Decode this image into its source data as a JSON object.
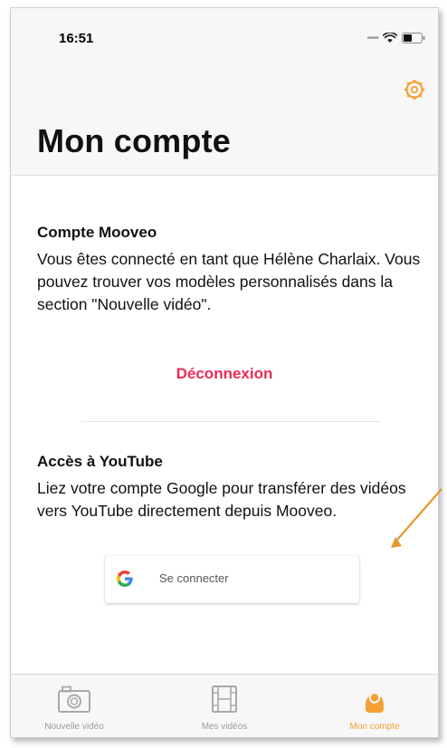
{
  "status_bar": {
    "time": "16:51"
  },
  "header": {
    "title": "Mon compte",
    "settings_icon": "gear-icon"
  },
  "mooveo_section": {
    "heading": "Compte Mooveo",
    "body": "Vous êtes connecté en tant que Hélène Charlaix. Vous pouvez trouver vos modèles personnalisés dans la section \"Nouvelle vidéo\".",
    "logout_label": "Déconnexion"
  },
  "youtube_section": {
    "heading": "Accès à YouTube",
    "body": "Liez votre compte Google pour transférer des vidéos vers YouTube directement depuis Mooveo.",
    "google_button_label": "Se connecter"
  },
  "tabbar": {
    "tabs": [
      {
        "label": "Nouvelle vidéo",
        "icon": "camera-icon",
        "active": false
      },
      {
        "label": "Mes vidéos",
        "icon": "film-icon",
        "active": false
      },
      {
        "label": "Mon compte",
        "icon": "person-icon",
        "active": true
      }
    ]
  },
  "colors": {
    "accent": "#f4a033",
    "logout": "#ee2a58",
    "annotation_arrow": "#e8962a"
  }
}
